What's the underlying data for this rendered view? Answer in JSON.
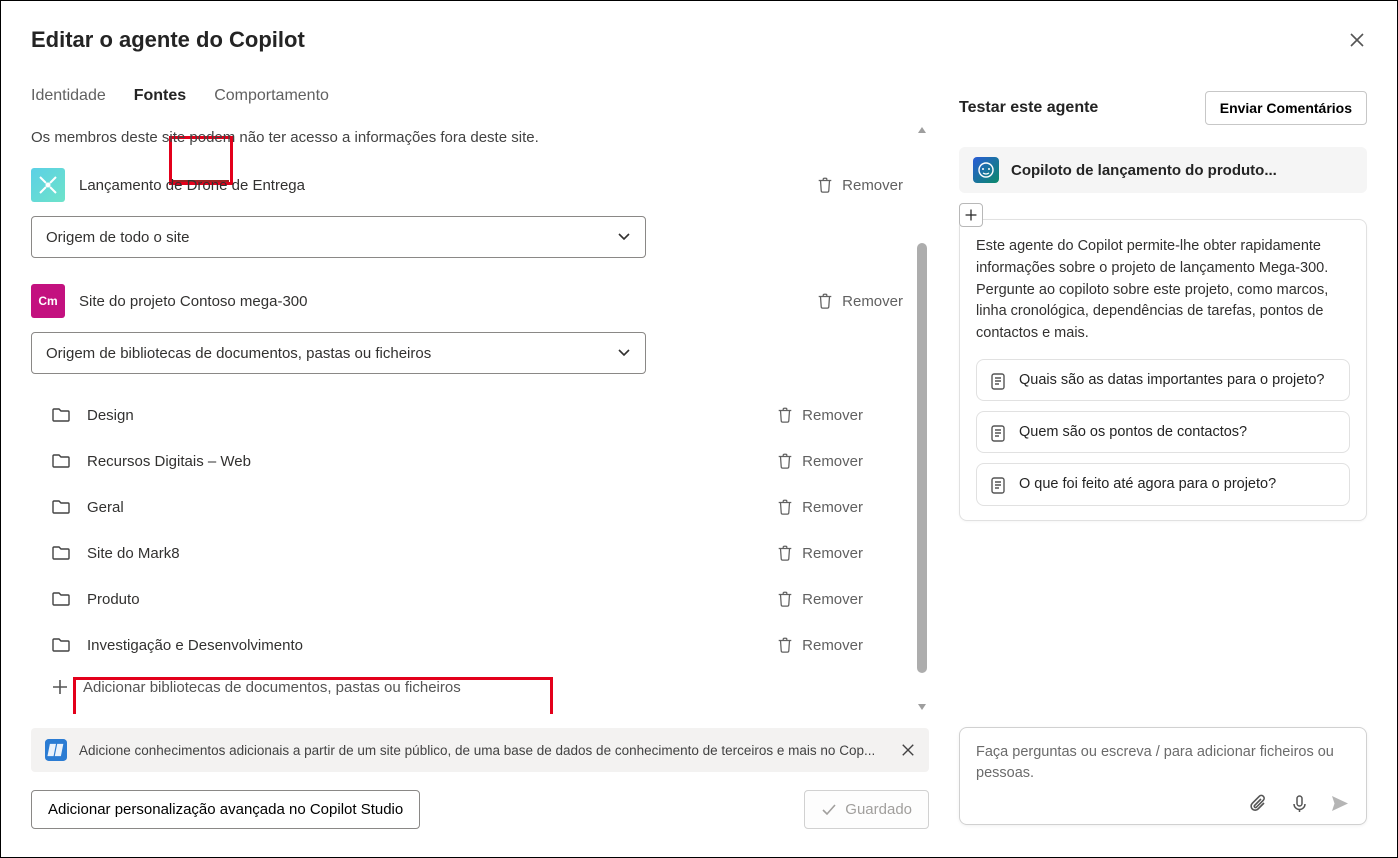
{
  "header": {
    "title": "Editar o agente do Copilot"
  },
  "tabs": {
    "identity": "Identidade",
    "sources": "Fontes",
    "behavior": "Comportamento",
    "active": "sources"
  },
  "sources": {
    "note": "Os membros deste site podem não ter acesso a informações fora deste site.",
    "remove_label": "Remover",
    "site1": {
      "name": "Lançamento de Drone de Entrega"
    },
    "dropdown1": "Origem de todo o site",
    "site2": {
      "name": "Site do projeto Contoso mega-300",
      "badge": "Cm"
    },
    "dropdown2": "Origem de bibliotecas de documentos, pastas ou ficheiros",
    "folders": [
      {
        "name": "Design"
      },
      {
        "name": "Recursos Digitais – Web"
      },
      {
        "name": "Geral"
      },
      {
        "name": "Site do Mark8"
      },
      {
        "name": "Produto"
      },
      {
        "name": "Investigação e Desenvolvimento"
      }
    ],
    "add_label": "Adicionar bibliotecas de documentos, pastas ou ficheiros"
  },
  "info_bar": "Adicione conhecimentos adicionais a partir de um site público, de uma base de dados de conhecimento de terceiros e mais no Cop...",
  "footer": {
    "advanced": "Adicionar personalização avançada no Copilot Studio",
    "saved": "Guardado"
  },
  "test_panel": {
    "heading": "Testar este agente",
    "feedback": "Enviar Comentários",
    "agent_name": "Copiloto de lançamento do produto...",
    "intro": "Este agente do Copilot permite-lhe obter rapidamente informações sobre o projeto de lançamento Mega-300. Pergunte ao copiloto sobre este projeto, como marcos, linha cronológica, dependências de tarefas, pontos de contactos e mais.",
    "suggestions": [
      "Quais são as datas importantes para o projeto?",
      "Quem são os pontos de contactos?",
      "O que foi feito até agora para o projeto?"
    ],
    "placeholder": "Faça perguntas ou escreva / para adicionar ficheiros ou pessoas."
  }
}
